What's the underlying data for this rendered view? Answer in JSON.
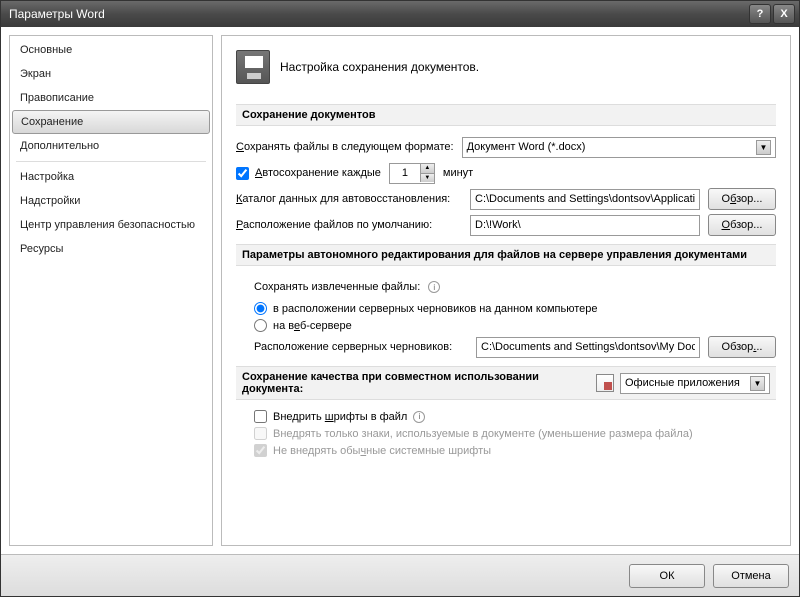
{
  "window": {
    "title": "Параметры Word"
  },
  "titlebar": {
    "help": "?",
    "close": "X"
  },
  "sidebar": {
    "items": [
      {
        "label": "Основные"
      },
      {
        "label": "Экран"
      },
      {
        "label": "Правописание"
      },
      {
        "label": "Сохранение",
        "selected": true
      },
      {
        "label": "Дополнительно"
      },
      {
        "label": "Настройка"
      },
      {
        "label": "Надстройки"
      },
      {
        "label": "Центр управления безопасностью"
      },
      {
        "label": "Ресурсы"
      }
    ]
  },
  "header": {
    "text": "Настройка сохранения документов."
  },
  "groups": {
    "save_docs": {
      "title": "Сохранение документов",
      "format_label": "Сохранять файлы в следующем формате:",
      "format_value": "Документ Word (*.docx)",
      "autosave_label": "Автосохранение каждые",
      "autosave_value": "1",
      "autosave_unit": "минут",
      "autorecover_label": "Каталог данных для автовосстановления:",
      "autorecover_value": "C:\\Documents and Settings\\dontsov\\Applicatio",
      "default_loc_label": "Расположение файлов по умолчанию:",
      "default_loc_value": "D:\\!Work\\",
      "browse": "Обзор..."
    },
    "offline": {
      "title": "Параметры автономного редактирования для файлов на сервере управления документами",
      "save_checked_label": "Сохранять извлеченные файлы:",
      "opt_drafts": "в расположении серверных черновиков на данном компьютере",
      "opt_web": "на веб-сервере",
      "drafts_loc_label": "Расположение серверных черновиков:",
      "drafts_loc_value": "C:\\Documents and Settings\\dontsov\\My Docume",
      "browse": "Обзор..."
    },
    "quality": {
      "title": "Сохранение качества при совместном использовании документа:",
      "target_value": "Офисные приложения",
      "embed_label": "Внедрить шрифты в файл",
      "embed_sub1": "Внедрять только знаки, используемые в документе (уменьшение размера файла)",
      "embed_sub2": "Не внедрять обычные системные шрифты"
    }
  },
  "footer": {
    "ok": "ОК",
    "cancel": "Отмена"
  }
}
